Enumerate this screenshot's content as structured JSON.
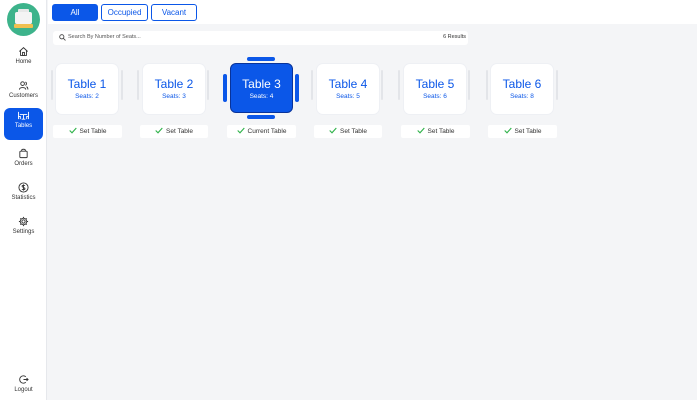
{
  "sidebar": {
    "logo_icon": "cash-register-icon",
    "items": [
      {
        "label": "Home",
        "icon": "home-icon"
      },
      {
        "label": "Customers",
        "icon": "customers-icon"
      },
      {
        "label": "Tables",
        "icon": "tables-icon",
        "active": true
      },
      {
        "label": "Orders",
        "icon": "orders-icon"
      },
      {
        "label": "Statistics",
        "icon": "dollar-icon"
      },
      {
        "label": "Settings",
        "icon": "gear-icon"
      }
    ],
    "logout_label": "Logout"
  },
  "filters": {
    "all": "All",
    "occupied": "Occupied",
    "vacant": "Vacant",
    "selected": "All"
  },
  "search": {
    "placeholder": "Search By Number of Seats...",
    "results": "6 Results"
  },
  "tables": [
    {
      "name": "Table 1",
      "seats": "Seats: 2",
      "action": "Set Table"
    },
    {
      "name": "Table 2",
      "seats": "Seats: 3",
      "action": "Set Table"
    },
    {
      "name": "Table 3",
      "seats": "Seats: 4",
      "action": "Current Table",
      "current": true
    },
    {
      "name": "Table 4",
      "seats": "Seats: 5",
      "action": "Set Table"
    },
    {
      "name": "Table 5",
      "seats": "Seats: 6",
      "action": "Set Table"
    },
    {
      "name": "Table 6",
      "seats": "Seats: 8",
      "action": "Set Table"
    }
  ],
  "colors": {
    "accent": "#0b57e8",
    "check": "#2fb24a",
    "logo": "#3db38b"
  }
}
